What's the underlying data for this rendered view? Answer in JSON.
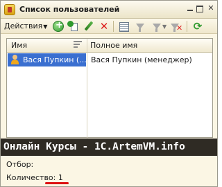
{
  "window": {
    "title": "Список пользователей"
  },
  "toolbar": {
    "actions_label": "Действия",
    "icons": [
      "add-icon",
      "copy-icon",
      "edit-icon",
      "delete-icon",
      "list-settings-icon",
      "filter-icon",
      "filter-list-icon",
      "filter-off-icon",
      "refresh-icon"
    ]
  },
  "table": {
    "columns": [
      "Имя",
      "Полное имя"
    ],
    "rows": [
      {
        "name": "Вася Пупкин (...",
        "full_name": "Вася Пупкин (менеджер)",
        "selected": true
      }
    ]
  },
  "banner": {
    "text": "Онлайн Курсы - 1C.ArtemVM.info"
  },
  "footer": {
    "filter_label": "Отбор:",
    "count_label": "Количество: 1"
  },
  "colors": {
    "selection": "#3a6fd0",
    "window_bg": "#fbf6e4",
    "banner_bg": "#2f2b24",
    "underline": "#dd1111"
  }
}
